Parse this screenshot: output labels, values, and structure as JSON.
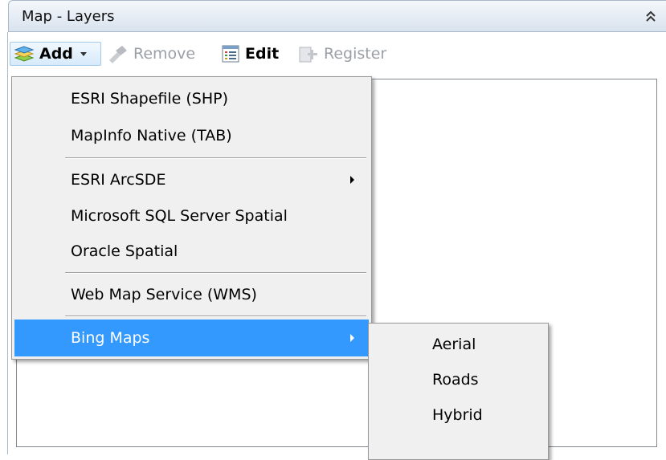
{
  "panel": {
    "title": "Map - Layers"
  },
  "toolbar": {
    "add_label": "Add",
    "remove_label": "Remove",
    "edit_label": "Edit",
    "register_label": "Register"
  },
  "add_menu": {
    "items": [
      {
        "label": "ESRI Shapefile (SHP)"
      },
      {
        "label": "MapInfo Native (TAB)"
      },
      {
        "label": "ESRI ArcSDE"
      },
      {
        "label": "Microsoft SQL Server Spatial"
      },
      {
        "label": "Oracle Spatial"
      },
      {
        "label": "Web Map Service (WMS)"
      },
      {
        "label": "Bing Maps"
      }
    ]
  },
  "bing_submenu": {
    "items": [
      {
        "label": "Aerial"
      },
      {
        "label": "Roads"
      },
      {
        "label": "Hybrid"
      }
    ]
  },
  "colors": {
    "highlight": "#3399ff",
    "menu_bg": "#f0f0f0",
    "title_bg": "#d9e3ee"
  }
}
